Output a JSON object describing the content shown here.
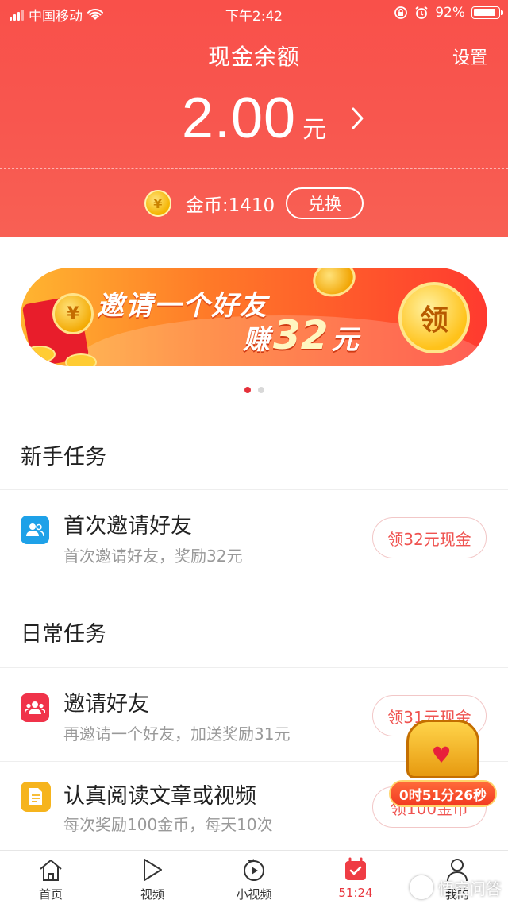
{
  "status_bar": {
    "carrier": "中国移动",
    "time": "下午2:42",
    "battery": "92%"
  },
  "header": {
    "title": "现金余额",
    "settings_label": "设置",
    "balance_value": "2.00",
    "balance_unit": "元",
    "coins_text": "金币:1410",
    "exchange_label": "兑换"
  },
  "banner": {
    "line1": "邀请一个好友",
    "line2_prefix": "赚",
    "line2_amount": "32",
    "line2_unit": "元",
    "claim_label": "领",
    "slide_count": 2,
    "active_slide": 1
  },
  "sections": [
    {
      "title": "新手任务"
    },
    {
      "title": "日常任务"
    }
  ],
  "tasks": [
    {
      "icon": "people-icon",
      "title": "首次邀请好友",
      "desc": "首次邀请好友，奖励32元",
      "button": "领32元现金",
      "color": "#1ea1e8"
    },
    {
      "icon": "people-icon",
      "title": "邀请好友",
      "desc": "再邀请一个好友，加送奖励31元",
      "button": "领31元现金",
      "color": "#f0334a"
    },
    {
      "icon": "document-icon",
      "title": "认真阅读文章或视频",
      "desc": "每次奖励100金币，每天10次",
      "button": "领100金币",
      "color": "#f6b41d"
    }
  ],
  "chest": {
    "timer": "0时51分26秒"
  },
  "tabbar": {
    "items": [
      {
        "label": "首页",
        "icon": "home-icon"
      },
      {
        "label": "视频",
        "icon": "play-icon"
      },
      {
        "label": "小视频",
        "icon": "short-video-icon"
      },
      {
        "label": "51:24",
        "icon": "calendar-check-icon"
      },
      {
        "label": "我的",
        "icon": "profile-icon"
      }
    ],
    "active_index": 3
  },
  "watermark": {
    "text": "悟空问答"
  },
  "colors": {
    "brand_red": "#f9504a",
    "accent": "#e8353d",
    "muted_text": "#999999"
  }
}
